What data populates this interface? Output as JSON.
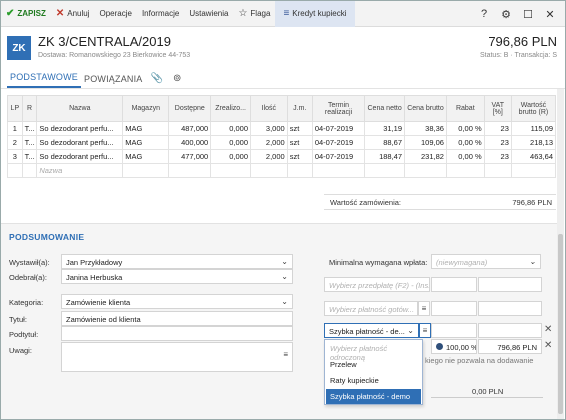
{
  "toolbar": {
    "save": "ZAPISZ",
    "cancel": "Anuluj",
    "operations": "Operacje",
    "info": "Informacje",
    "settings": "Ustawienia",
    "flag": "Flaga",
    "credit": "Kredyt kupiecki"
  },
  "header": {
    "badge": "ZK",
    "title": "ZK 3/CENTRALA/2019",
    "subtitle": "Dostawa: Romanowskiego 23  Bierkowice 44-753",
    "amount": "796,86 PLN",
    "status": "Status: B  ·  Transakcja: S"
  },
  "tabs": {
    "main": "PODSTAWOWE",
    "relations": "POWIĄZANIA"
  },
  "grid": {
    "columns": [
      "LP",
      "R",
      "Nazwa",
      "Magazyn",
      "Dostępne",
      "Zrealizo...",
      "Ilość",
      "J.m.",
      "Termin realizacji",
      "Cena netto",
      "Cena brutto",
      "Rabat",
      "VAT [%]",
      "Wartość brutto (R)"
    ],
    "rows": [
      [
        "1",
        "T...",
        "So dezodorant perfu...",
        "MAG",
        "487,000",
        "0,000",
        "3,000",
        "szt",
        "04-07-2019",
        "31,19",
        "38,36",
        "0,00 %",
        "23",
        "115,09"
      ],
      [
        "2",
        "T...",
        "So dezodorant perfu...",
        "MAG",
        "400,000",
        "0,000",
        "2,000",
        "szt",
        "04-07-2019",
        "88,67",
        "109,06",
        "0,00 %",
        "23",
        "218,13"
      ],
      [
        "3",
        "T...",
        "So dezodorant perfu...",
        "MAG",
        "477,000",
        "0,000",
        "2,000",
        "szt",
        "04-07-2019",
        "188,47",
        "231,82",
        "0,00 %",
        "23",
        "463,64"
      ]
    ],
    "new_row_placeholder": "Nazwa"
  },
  "order_value": {
    "label": "Wartość zamówienia:",
    "value": "796,86 PLN"
  },
  "summary": {
    "title": "PODSUMOWANIE",
    "issued_by_label": "Wystawił(a):",
    "issued_by": "Jan Przykładowy",
    "received_by_label": "Odebrał(a):",
    "received_by": "Janina Herbuska",
    "category_label": "Kategoria:",
    "category": "Zamówienie klienta",
    "title_label": "Tytuł:",
    "title_value": "Zamówienie od klienta",
    "subtitle_label": "Podtytuł:",
    "notes_label": "Uwagi:",
    "min_payment_label": "Minimalna wymagana wpłata:",
    "min_payment_placeholder": "(niewymagana)",
    "prepayment_placeholder": "Wybierz przedpłatę (F2) - (Ins...",
    "payment_placeholder": "Wybierz płatność gotów...",
    "payment_selected": "Szybka płatność - de...",
    "percent": "100,00 %",
    "amount": "796,86 PLN",
    "info_text": "kiego nie pozwala na dodawanie",
    "total": "0,00 PLN"
  },
  "dropdown": {
    "placeholder": "Wybierz płatność odroczoną",
    "items": [
      "Przelew",
      "Raty kupieckie",
      "Szybka płatność - demo"
    ]
  }
}
